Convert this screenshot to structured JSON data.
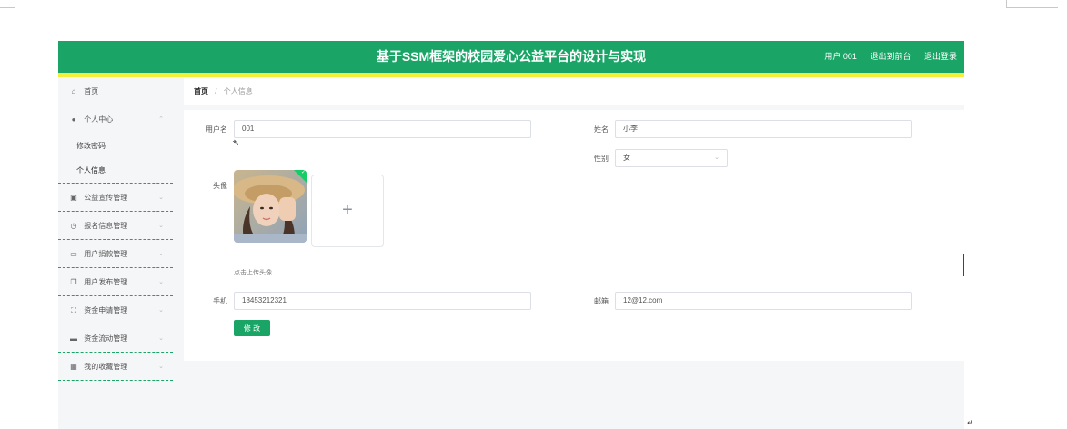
{
  "header": {
    "title": "基于SSM框架的校园爱心公益平台的设计与实现",
    "user": "用户 001",
    "back_to_front": "退出到前台",
    "logout": "退出登录"
  },
  "sidebar": {
    "home": {
      "label": "首页",
      "icon": "home-icon"
    },
    "personal_center": {
      "label": "个人中心",
      "icon": "user-icon",
      "chevron": "⌃",
      "children": [
        {
          "label": "修改密码"
        },
        {
          "label": "个人信息"
        }
      ]
    },
    "items": [
      {
        "label": "公益宣传管理",
        "icon": "document-icon"
      },
      {
        "label": "报名信息管理",
        "icon": "clock-icon"
      },
      {
        "label": "用户捐款管理",
        "icon": "chat-icon"
      },
      {
        "label": "用户发布管理",
        "icon": "copy-icon"
      },
      {
        "label": "资金申请管理",
        "icon": "fullscreen-icon"
      },
      {
        "label": "资金流动管理",
        "icon": "briefcase-icon"
      },
      {
        "label": "我的收藏管理",
        "icon": "grid-icon"
      }
    ],
    "chevron_down": "⌄"
  },
  "breadcrumb": {
    "home": "首页",
    "separator": "/",
    "current": "个人信息"
  },
  "form": {
    "username_label": "用户名",
    "username_value": "001",
    "name_label": "姓名",
    "name_value": "小李",
    "gender_label": "性别",
    "gender_value": "女",
    "avatar_label": "头像",
    "upload_plus": "+",
    "upload_hint": "点击上传头像",
    "phone_label": "手机",
    "phone_value": "18453212321",
    "email_label": "邮箱",
    "email_value": "12@12.com",
    "submit_label": "修 改"
  },
  "colors": {
    "primary": "#1aa567",
    "accent_stripe": "#f5ef3a",
    "background": "#f5f6f8"
  }
}
